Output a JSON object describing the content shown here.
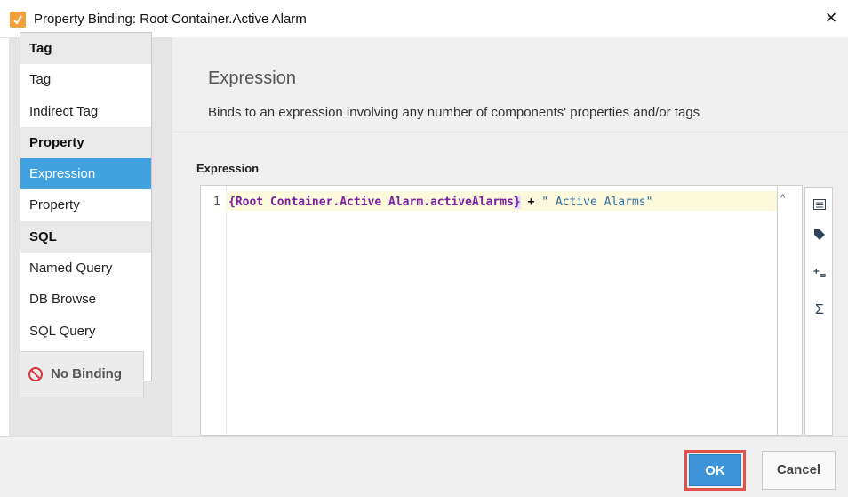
{
  "window": {
    "title": "Property Binding: Root Container.Active Alarm",
    "close_glyph": "×"
  },
  "sidebar": {
    "items": [
      {
        "label": "Tag",
        "kind": "header"
      },
      {
        "label": "Tag",
        "kind": "item"
      },
      {
        "label": "Indirect Tag",
        "kind": "item"
      },
      {
        "label": "Property",
        "kind": "header"
      },
      {
        "label": "Expression",
        "kind": "item",
        "selected": true
      },
      {
        "label": "Property",
        "kind": "item"
      },
      {
        "label": "SQL",
        "kind": "header"
      },
      {
        "label": "Named Query",
        "kind": "item"
      },
      {
        "label": "DB Browse",
        "kind": "item"
      },
      {
        "label": "SQL Query",
        "kind": "item"
      }
    ],
    "no_binding_label": "No Binding"
  },
  "section": {
    "title": "Expression",
    "description": "Binds to an expression involving any number of components' properties and/or tags"
  },
  "editor": {
    "label": "Expression",
    "line_number": "1",
    "code": {
      "prop": "{Root Container.Active Alarm.activeAlarms",
      "brace": "}",
      "op": " + ",
      "str": "\" Active Alarms\""
    }
  },
  "tools": {
    "icons": [
      "list-icon",
      "tag-icon",
      "operators-icon",
      "sigma-icon"
    ],
    "ops_glyph": "⁺₌",
    "sigma_glyph": "Σ"
  },
  "buttons": {
    "ok_label": "OK",
    "cancel_label": "Cancel"
  },
  "colors": {
    "accent": "#40a3e0",
    "ok_button": "#3d94d8",
    "highlight_outline": "#e3524a"
  }
}
